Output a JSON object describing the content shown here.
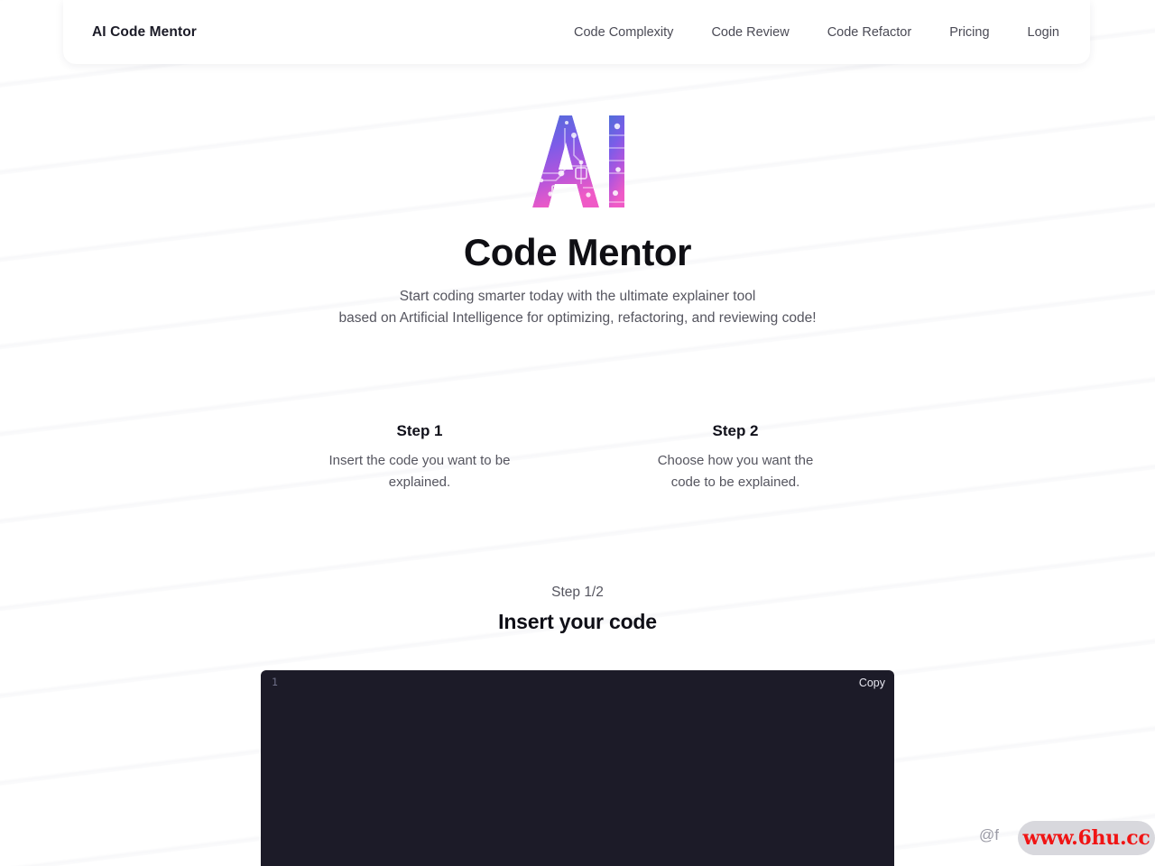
{
  "header": {
    "brand": "AI Code Mentor",
    "nav": [
      {
        "label": "Code Complexity",
        "name": "nav-code-complexity"
      },
      {
        "label": "Code Review",
        "name": "nav-code-review"
      },
      {
        "label": "Code Refactor",
        "name": "nav-code-refactor"
      },
      {
        "label": "Pricing",
        "name": "nav-pricing"
      },
      {
        "label": "Login",
        "name": "nav-login"
      }
    ]
  },
  "hero": {
    "logo_text": "AI",
    "logo_icon": "ai-circuit-logo",
    "title": "Code Mentor",
    "subtitle_line1": "Start coding smarter today with the ultimate explainer tool",
    "subtitle_line2": "based on Artificial Intelligence for optimizing, refactoring, and reviewing code!",
    "colors": {
      "logo_gradient_start": "#4f6ed8",
      "logo_gradient_mid": "#8b5cf6",
      "logo_gradient_end": "#e255c8"
    }
  },
  "steps": [
    {
      "title": "Step 1",
      "description_line1": "Insert the code you want to be",
      "description_line2": "explained."
    },
    {
      "title": "Step 2",
      "description_line1": "Choose how you want the",
      "description_line2": "code to be explained."
    }
  ],
  "step_indicator": {
    "counter": "Step 1/2",
    "heading": "Insert your code"
  },
  "editor": {
    "line_number": "1",
    "copy_label": "Copy",
    "value": "",
    "placeholder": "",
    "background_color": "#1c1b28"
  },
  "watermark": {
    "handle": "@f",
    "url": "www.6hu.cc",
    "url_color": "#f01414"
  }
}
